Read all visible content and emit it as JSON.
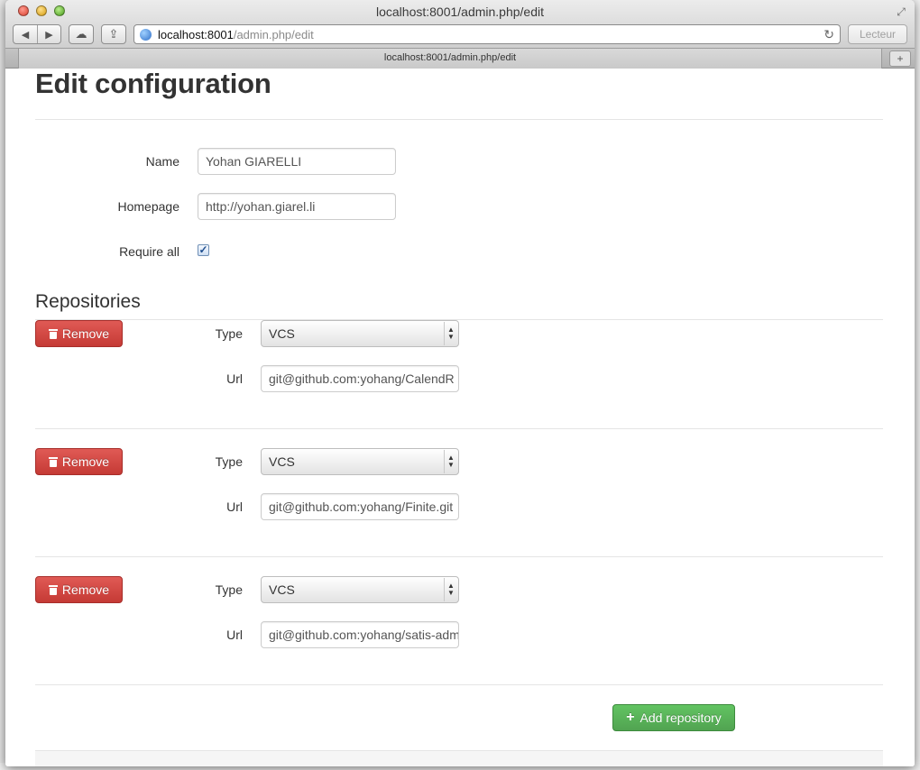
{
  "window": {
    "title": "localhost:8001/admin.php/edit",
    "url_host": "localhost:8001",
    "url_path": "/admin.php/edit",
    "reader_label": "Lecteur",
    "tab_title": "localhost:8001/admin.php/edit"
  },
  "page": {
    "title": "Edit configuration",
    "form": {
      "name_label": "Name",
      "name_value": "Yohan GIARELLI",
      "homepage_label": "Homepage",
      "homepage_value": "http://yohan.giarel.li",
      "require_all_label": "Require all",
      "require_all_checked": true
    },
    "repositories_heading": "Repositories",
    "repositories": [
      {
        "remove_label": "Remove",
        "type_label": "Type",
        "type_value": "VCS",
        "url_label": "Url",
        "url_value": "git@github.com:yohang/CalendR"
      },
      {
        "remove_label": "Remove",
        "type_label": "Type",
        "type_value": "VCS",
        "url_label": "Url",
        "url_value": "git@github.com:yohang/Finite.git"
      },
      {
        "remove_label": "Remove",
        "type_label": "Type",
        "type_value": "VCS",
        "url_label": "Url",
        "url_value": "git@github.com:yohang/satis-admin"
      }
    ],
    "add_repository_label": "Add repository"
  },
  "colors": {
    "remove_button": "#d2443f",
    "add_button": "#5bb75b",
    "heading_text": "#333333"
  }
}
